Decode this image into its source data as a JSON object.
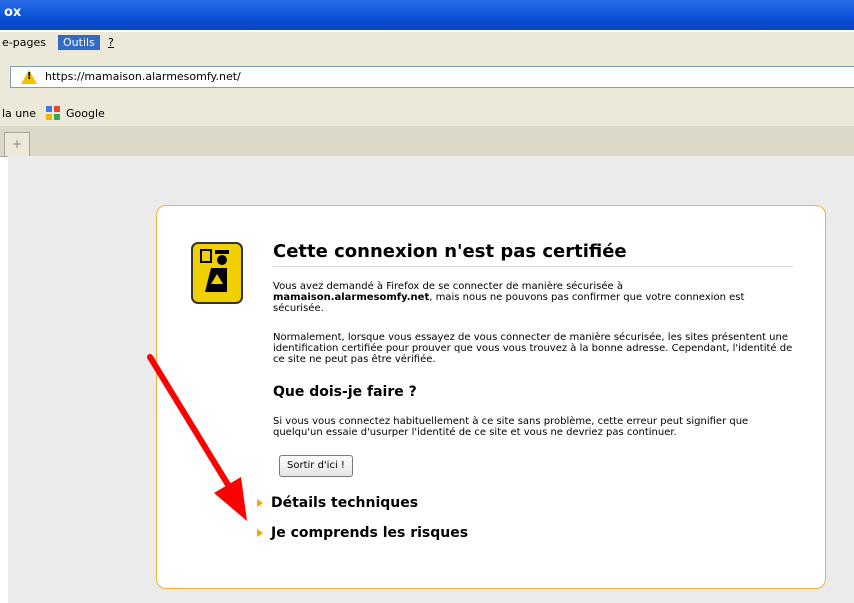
{
  "window": {
    "title": "ox"
  },
  "menubar": {
    "items": [
      "e-pages",
      "Outils",
      "?"
    ]
  },
  "navbar": {
    "url": "https://mamaison.alarmesomfy.net/"
  },
  "bookmarks": {
    "items": [
      "la une",
      "Google"
    ]
  },
  "error": {
    "title": "Cette connexion n'est pas certifiée",
    "p1_before": "Vous avez demandé à Firefox de se connecter de manière sécurisée à",
    "p1_host": "mamaison.alarmesomfy.net",
    "p1_after": ", mais nous ne pouvons pas confirmer que votre connexion est sécurisée.",
    "p2": "Normalement, lorsque vous essayez de vous connecter de manière sécurisée, les sites présentent une identification certifiée pour prouver que vous vous trouvez à la bonne adresse. Cependant, l'identité de ce site ne peut pas être vérifiée.",
    "what_heading": "Que dois-je faire ?",
    "p3": "Si vous vous connectez habituellement à ce site sans problème, cette erreur peut signifier que quelqu'un essaie d'usurper l'identité de ce site et vous ne devriez pas continuer.",
    "get_out_button": "Sortir d'ici !",
    "technical_details": "Détails techniques",
    "understand_risks": "Je comprends les risques"
  },
  "colors": {
    "accent": "#f2b134",
    "annotation_arrow": "#ff0000",
    "titlebar": "#0a4fd6"
  }
}
